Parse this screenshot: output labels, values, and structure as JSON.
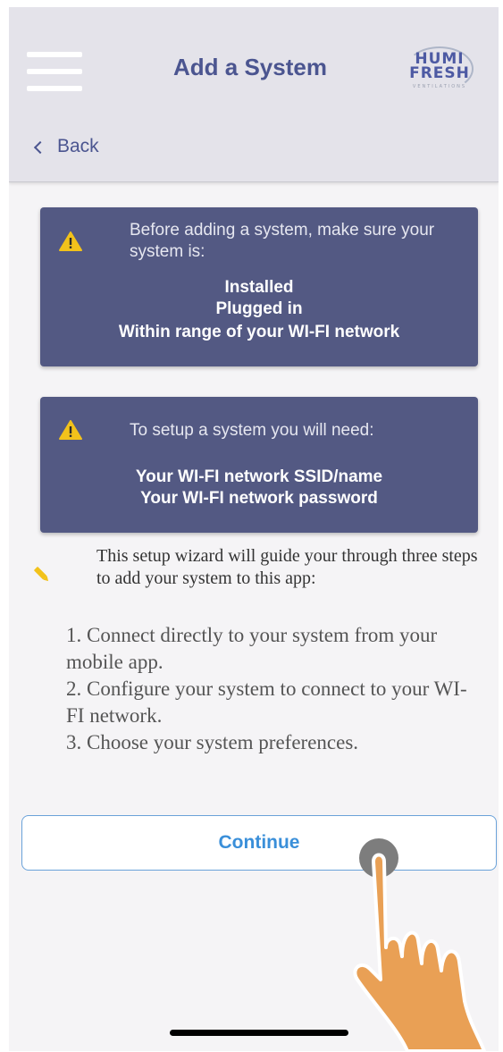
{
  "header": {
    "title": "Add a System",
    "back_label": "Back",
    "logo": {
      "line1": "HUMI",
      "line2": "FRESH",
      "tagline": "VENTILATIONS"
    }
  },
  "notice_installed": {
    "icon": "warning-icon",
    "lead": "Before adding a system, make sure your system is:",
    "items": [
      "Installed",
      "Plugged in",
      "Within range of your WI-FI network"
    ]
  },
  "notice_requirements": {
    "icon": "warning-icon",
    "lead": "To setup a system you will need:",
    "items": [
      "Your WI-FI network SSID/name",
      "Your WI-FI network password"
    ]
  },
  "wizard": {
    "icon": "pencil-icon",
    "intro": "This setup wizard will guide your through three steps to add your system to this app:",
    "steps": [
      "1. Connect directly to your system from your mobile app.",
      "2. Configure your system to connect to your WI-FI network.",
      "3. Choose your system preferences."
    ]
  },
  "actions": {
    "continue_label": "Continue"
  },
  "colors": {
    "header_bg": "#e4e3ea",
    "card_bg": "#535983",
    "accent_blue": "#3a8fd9",
    "title": "#4b5590",
    "warning": "#f2c21b"
  }
}
